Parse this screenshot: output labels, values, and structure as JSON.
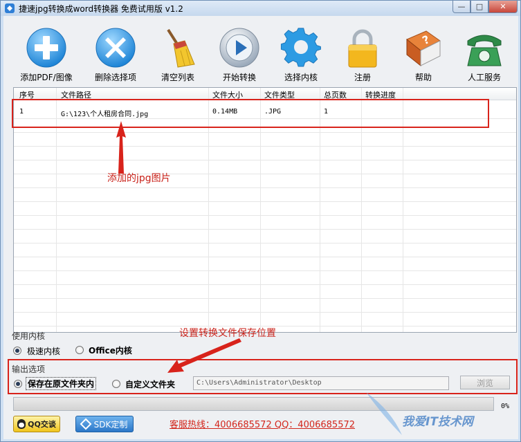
{
  "window": {
    "title": "捷速jpg转换成word转换器 免费试用版 v1.2",
    "controls": {
      "minimize": "—",
      "maximize": "□",
      "close": "✕"
    }
  },
  "toolbar": {
    "items": [
      {
        "label": "添加PDF/图像",
        "icon": "add-icon"
      },
      {
        "label": "删除选择项",
        "icon": "delete-icon"
      },
      {
        "label": "清空列表",
        "icon": "broom-icon"
      },
      {
        "label": "开始转换",
        "icon": "play-icon"
      },
      {
        "label": "选择内核",
        "icon": "gear-icon"
      },
      {
        "label": "注册",
        "icon": "lock-icon"
      },
      {
        "label": "帮助",
        "icon": "help-book-icon"
      },
      {
        "label": "人工服务",
        "icon": "phone-icon"
      }
    ]
  },
  "file_list": {
    "columns": [
      "序号",
      "文件路径",
      "文件大小",
      "文件类型",
      "总页数",
      "转换进度"
    ],
    "rows": [
      {
        "index": "1",
        "path": "G:\\123\\个人租房合同.jpg",
        "size": "0.14MB",
        "type": ".JPG",
        "pages": "1",
        "progress": ""
      }
    ]
  },
  "annotations": {
    "list_note": "添加的jpg图片",
    "output_note": "设置转换文件保存位置",
    "color": "#d8231b"
  },
  "kernel": {
    "title": "使用内核",
    "options": [
      {
        "label": "极速内核",
        "selected": true
      },
      {
        "label": "Office内核",
        "selected": false
      }
    ]
  },
  "output": {
    "title": "输出选项",
    "options": [
      {
        "label": "保存在原文件夹内",
        "selected": true
      },
      {
        "label": "自定义文件夹",
        "selected": false
      }
    ],
    "path_value": "C:\\Users\\Administrator\\Desktop",
    "browse_label": "浏览"
  },
  "progress": {
    "percent_label": "0%",
    "value": 0
  },
  "footer": {
    "qq_label": "QQ交谈",
    "sdk_label": "SDK定制",
    "hotline": "客服热线：4006685572 QQ：4006685572"
  },
  "watermark": "我爱IT技术网"
}
